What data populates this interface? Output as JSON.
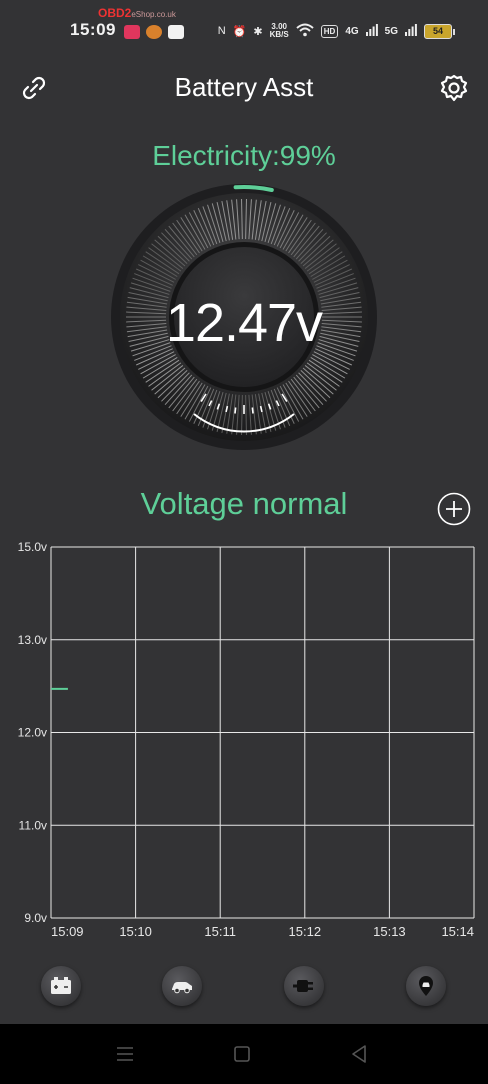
{
  "status_bar": {
    "time": "15:09",
    "watermark_brand": "OBD2",
    "watermark_suffix": "eShop.co.uk",
    "net_speed_value": "3.00",
    "net_speed_unit": "KB/S",
    "hd_label": "HD",
    "signal1": "4G",
    "signal2": "5G",
    "battery_level": "54"
  },
  "header": {
    "title": "Battery Asst",
    "left_icon": "link-icon",
    "right_icon": "gear-icon"
  },
  "electricity": {
    "label": "Electricity:99%",
    "percent": 99
  },
  "gauge": {
    "voltage": "12.47v",
    "needle_fraction": 0.52
  },
  "status": {
    "text": "Voltage normal",
    "add_icon": "plus-circle-icon"
  },
  "chart_data": {
    "type": "line",
    "y_tick_labels": [
      "15.0v",
      "13.0v",
      "12.0v",
      "11.0v",
      "9.0v"
    ],
    "x_tick_labels": [
      "15:09",
      "15:10",
      "15:11",
      "15:12",
      "15:13",
      "15:14"
    ],
    "series": [
      {
        "points": [
          [
            0.0,
            12.47
          ],
          [
            0.2,
            12.47
          ]
        ]
      }
    ],
    "grid": true,
    "line_color": "#5ecf98"
  },
  "bottom_nav": [
    {
      "name": "battery-icon"
    },
    {
      "name": "car-icon"
    },
    {
      "name": "plug-icon"
    },
    {
      "name": "location-icon"
    }
  ],
  "system_nav": [
    "menu-icon",
    "home-square-icon",
    "back-triangle-icon"
  ],
  "colors": {
    "accent": "#5ecf98",
    "background": "#333335"
  }
}
